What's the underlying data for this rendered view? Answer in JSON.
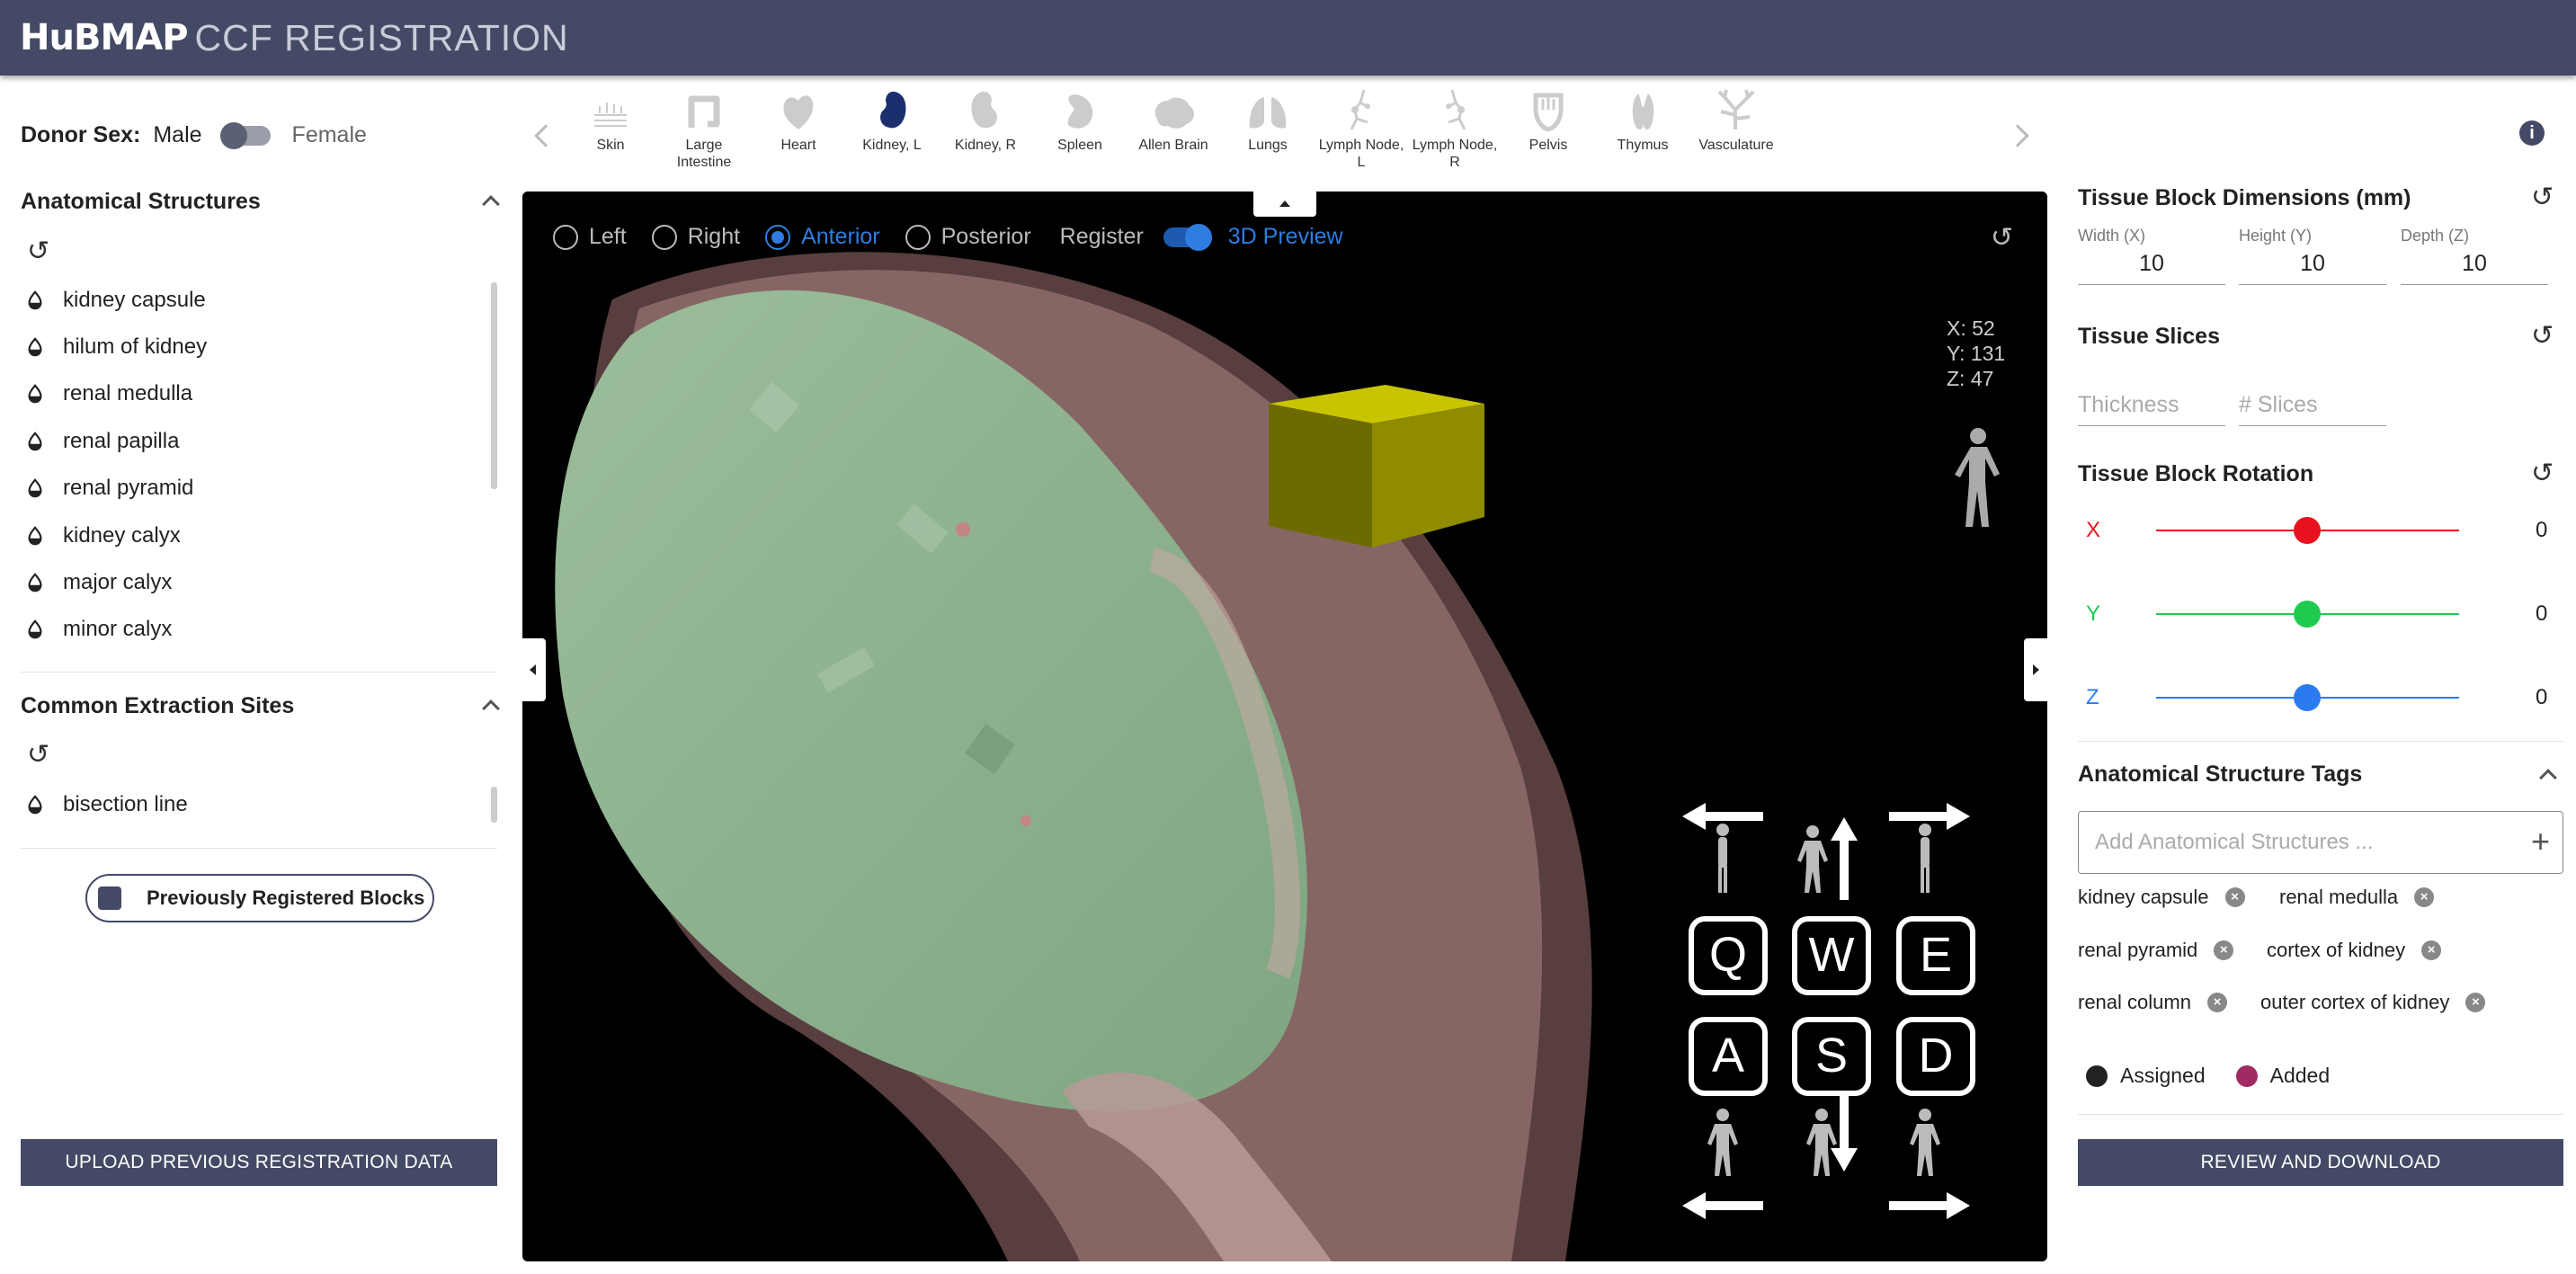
{
  "header": {
    "brand": "HuBMAP",
    "title": "CCF REGISTRATION"
  },
  "donor": {
    "label": "Donor Sex:",
    "male": "Male",
    "female": "Female",
    "selected": "Male"
  },
  "anatomical": {
    "title": "Anatomical Structures",
    "items": [
      "kidney capsule",
      "hilum of kidney",
      "renal medulla",
      "renal papilla",
      "renal pyramid",
      "kidney calyx",
      "major calyx",
      "minor calyx"
    ]
  },
  "extraction": {
    "title": "Common Extraction Sites",
    "items": [
      "bisection line"
    ]
  },
  "prev_blocks": "Previously Registered Blocks",
  "upload_button": "UPLOAD PREVIOUS REGISTRATION DATA",
  "organs": [
    "Skin",
    "Large Intestine",
    "Heart",
    "Kidney, L",
    "Kidney, R",
    "Spleen",
    "Allen Brain",
    "Lungs",
    "Lymph Node, L",
    "Lymph Node, R",
    "Pelvis",
    "Thymus",
    "Vasculature"
  ],
  "organ_selected": "Kidney, L",
  "viewer": {
    "views": [
      "Left",
      "Right",
      "Anterior",
      "Posterior"
    ],
    "selected_view": "Anterior",
    "register_label": "Register",
    "preview_label": "3D Preview",
    "coords": {
      "x": "X: 52",
      "y": "Y: 131",
      "z": "Z: 47"
    },
    "keys": [
      "Q",
      "W",
      "E",
      "A",
      "S",
      "D"
    ]
  },
  "block_dims": {
    "title": "Tissue Block Dimensions (mm)",
    "width_label": "Width (X)",
    "width": "10",
    "height_label": "Height (Y)",
    "height": "10",
    "depth_label": "Depth (Z)",
    "depth": "10"
  },
  "slices": {
    "title": "Tissue Slices",
    "thickness_placeholder": "Thickness",
    "slices_placeholder": "# Slices"
  },
  "rotation": {
    "title": "Tissue Block Rotation",
    "x_label": "X",
    "x_value": "0",
    "y_label": "Y",
    "y_value": "0",
    "z_label": "Z",
    "z_value": "0",
    "colors": {
      "x": "#e8121e",
      "y": "#1ecb4f",
      "z": "#2b7bf0"
    }
  },
  "tags": {
    "title": "Anatomical Structure Tags",
    "placeholder": "Add Anatomical Structures ...",
    "items": [
      "kidney capsule",
      "renal medulla",
      "renal pyramid",
      "cortex of kidney",
      "renal column",
      "outer cortex of kidney"
    ],
    "legend_assigned": "Assigned",
    "legend_added": "Added",
    "colors": {
      "assigned": "#222222",
      "added": "#a12a63"
    }
  },
  "review_button": "REVIEW AND DOWNLOAD",
  "theme": {
    "primary": "#444a65",
    "accent_blue": "#2f7de1"
  }
}
